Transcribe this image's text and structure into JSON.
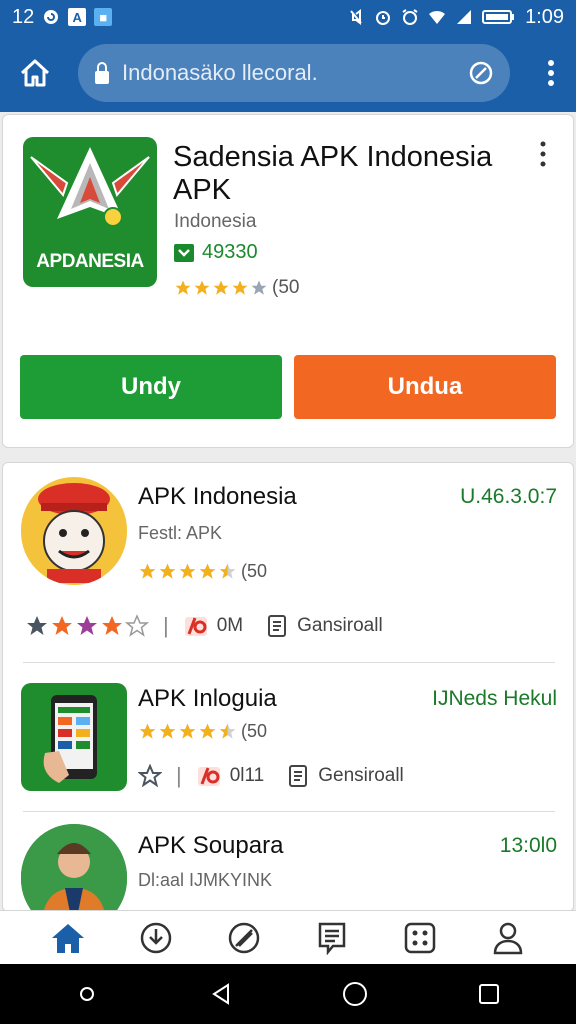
{
  "status_bar": {
    "left_text": "12",
    "time": "1:09"
  },
  "toolbar": {
    "url_text": "Indonasäko llecoral."
  },
  "featured": {
    "icon_label": "APDANESIA",
    "title": "Sadensia APK Indonesia APK",
    "subtitle": "Indonesia",
    "downloads": "49330",
    "rating": 4,
    "rating_text": "(50",
    "primary_button": "Undy",
    "secondary_button": "Undua"
  },
  "apps": [
    {
      "name": "APK Indonesia",
      "version": "U.46.3.0:7",
      "subtitle": "Festl: APK",
      "rating": 4.5,
      "rating_text": "(50",
      "meta_size": "0M",
      "meta_label": "Gansiroall"
    },
    {
      "name": "APK Inloguia",
      "version": "IJNeds Hekul",
      "rating": 4.5,
      "rating_text": "(50",
      "meta_size": "0l11",
      "meta_label": "Gensiroall"
    },
    {
      "name": "APK Soupara",
      "version": "13:0l0",
      "subtitle": "Dl:aal IJMKYINK"
    }
  ],
  "colors": {
    "header_blue": "#1a5fa8",
    "green": "#1e9c36",
    "orange": "#f26722",
    "star_gold": "#f2b01e"
  }
}
